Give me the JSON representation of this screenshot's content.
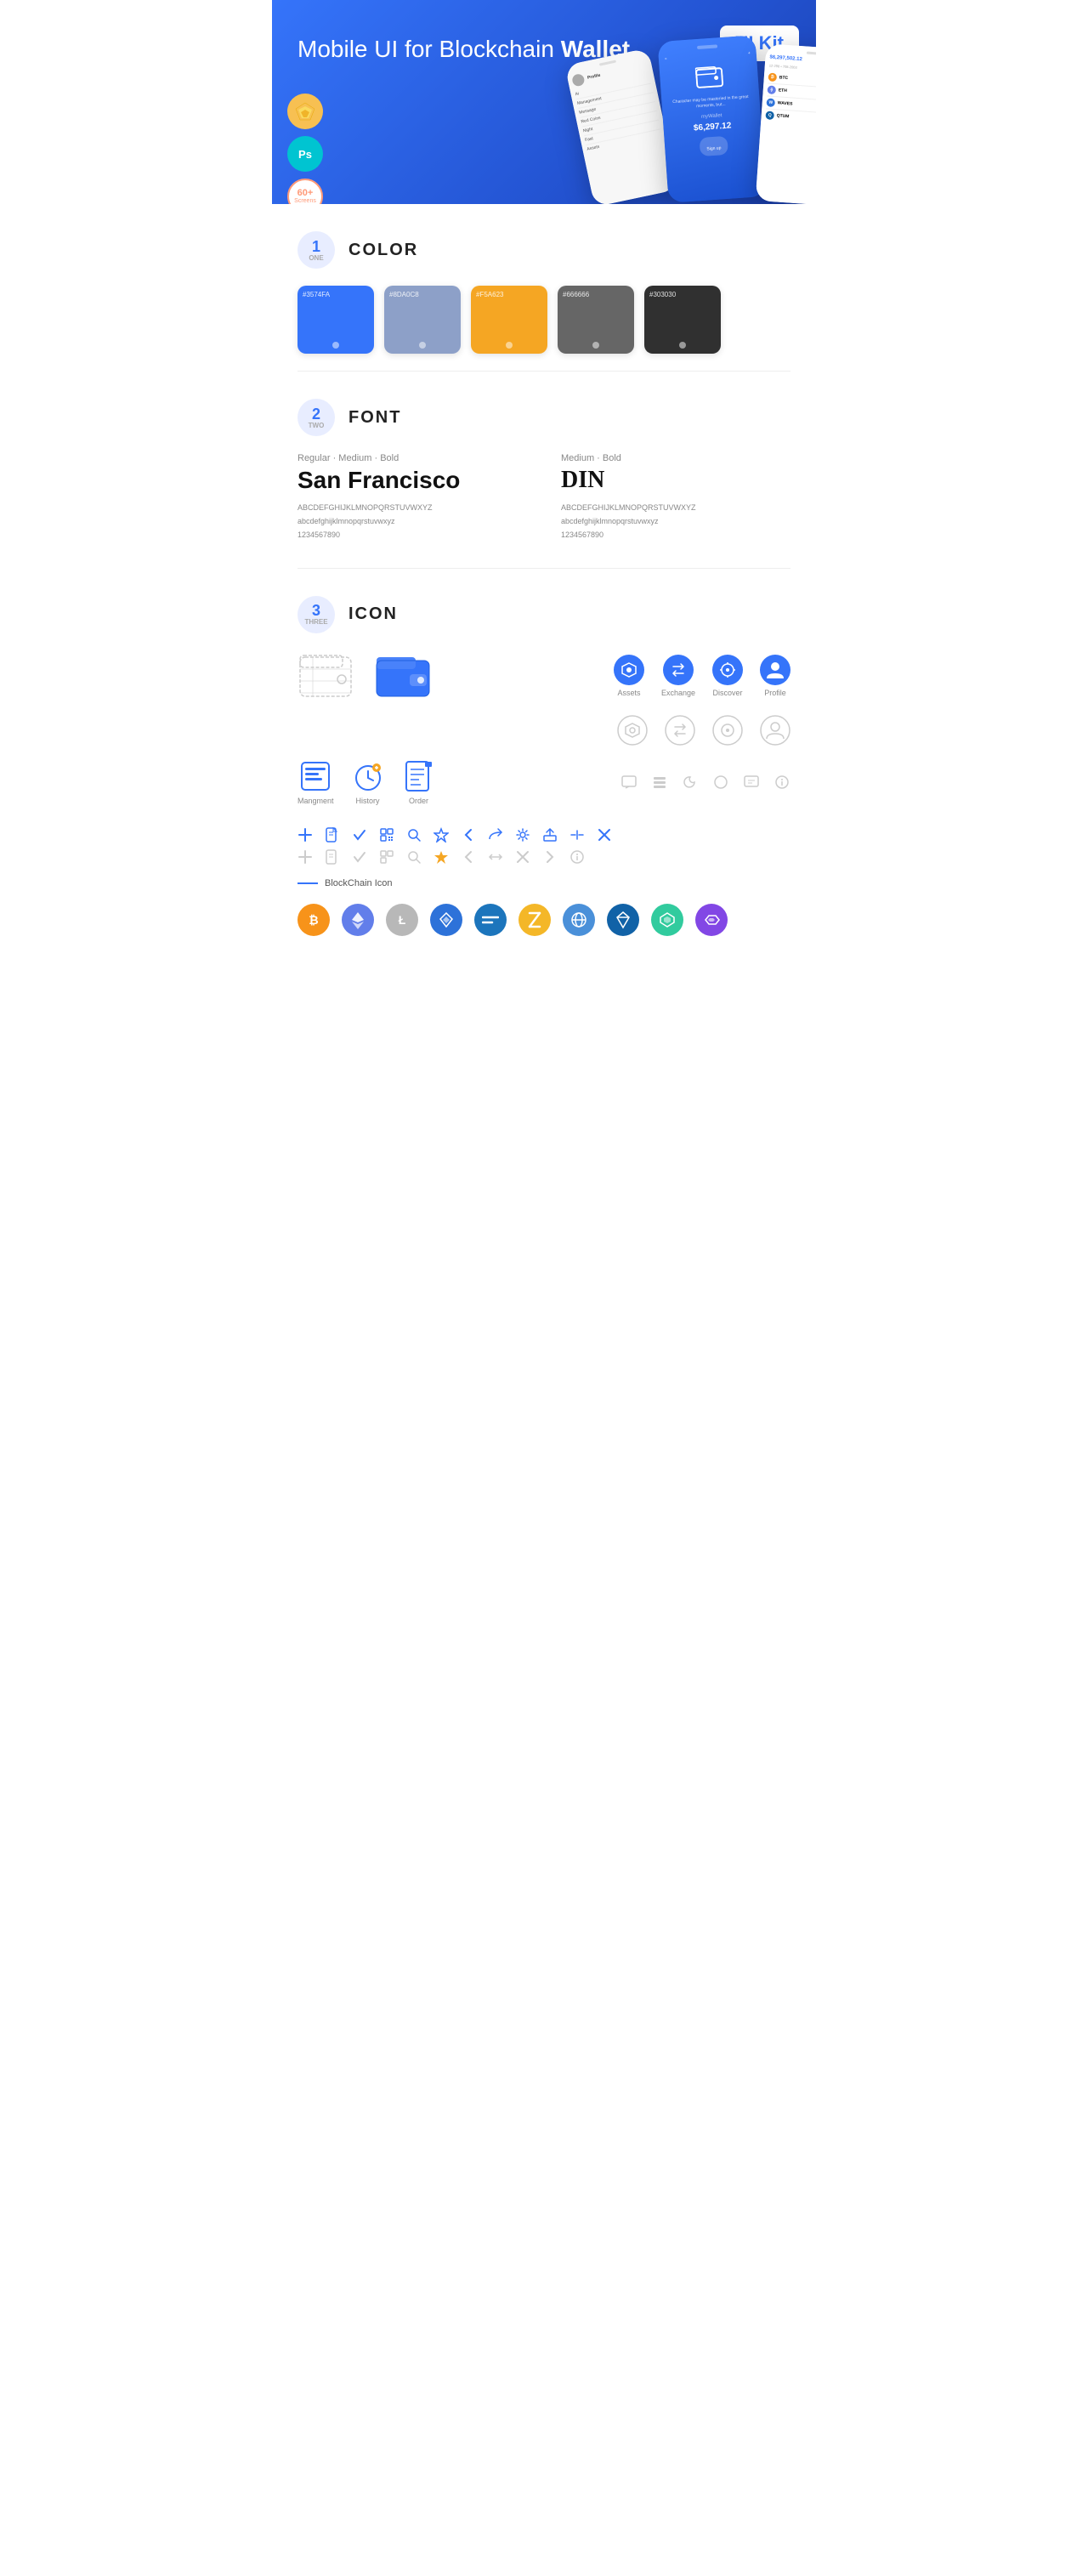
{
  "hero": {
    "title_normal": "Mobile UI for Blockchain ",
    "title_bold": "Wallet",
    "badge": "UI Kit",
    "sketch_icon": "Sk",
    "ps_icon": "Ps",
    "screens_count": "60+",
    "screens_label": "Screens"
  },
  "sections": {
    "color": {
      "num": "1",
      "word": "ONE",
      "title": "COLOR",
      "swatches": [
        {
          "hex": "#3574FA",
          "label": "3574FA"
        },
        {
          "hex": "#8DA0C8",
          "label": "8DA0C8"
        },
        {
          "hex": "#F5A623",
          "label": "F5A623"
        },
        {
          "hex": "#666666",
          "label": "666666"
        },
        {
          "hex": "#303030",
          "label": "303030"
        }
      ]
    },
    "font": {
      "num": "2",
      "word": "TWO",
      "title": "FONT",
      "font1": {
        "style": "Regular · Medium · Bold",
        "name": "San Francisco",
        "uppercase": "ABCDEFGHIJKLMNOPQRSTUVWXYZ",
        "lowercase": "abcdefghijklmnopqrstuvwxyz",
        "digits": "1234567890"
      },
      "font2": {
        "style": "Medium · Bold",
        "name": "DIN",
        "uppercase": "ABCDEFGHIJKLMNOPQRSTUVWXYZ",
        "lowercase": "abcdefghijklmnopqrstuvwxyz",
        "digits": "1234567890"
      }
    },
    "icon": {
      "num": "3",
      "word": "THREE",
      "title": "ICON",
      "nav_icons": [
        {
          "name": "Assets",
          "type": "filled-blue"
        },
        {
          "name": "Exchange",
          "type": "filled-blue"
        },
        {
          "name": "Discover",
          "type": "filled-blue"
        },
        {
          "name": "Profile",
          "type": "filled-blue"
        }
      ],
      "action_icons": [
        {
          "name": "Mangment",
          "label": "Mangment"
        },
        {
          "name": "History",
          "label": "History"
        },
        {
          "name": "Order",
          "label": "Order"
        }
      ],
      "blockchain_label": "BlockChain Icon",
      "crypto_icons": [
        {
          "name": "Bitcoin",
          "color": "#F7931A",
          "symbol": "₿"
        },
        {
          "name": "Ethereum",
          "color": "#627EEA",
          "symbol": "⟠"
        },
        {
          "name": "Litecoin",
          "color": "#A0A0A0",
          "symbol": "Ł"
        },
        {
          "name": "BlackCoin",
          "color": "#2D72D9",
          "symbol": "◆"
        },
        {
          "name": "Dash",
          "color": "#1C75BC",
          "symbol": "D"
        },
        {
          "name": "Zcash",
          "color": "#F4B728",
          "symbol": "Z"
        },
        {
          "name": "GridCoin",
          "color": "#4a90d9",
          "symbol": "◈"
        },
        {
          "name": "Ardor",
          "color": "#1162A7",
          "symbol": "A"
        },
        {
          "name": "Kyber",
          "color": "#31CB9E",
          "symbol": "◆"
        },
        {
          "name": "Polygon",
          "color": "#8247E5",
          "symbol": "⬡"
        }
      ]
    }
  }
}
